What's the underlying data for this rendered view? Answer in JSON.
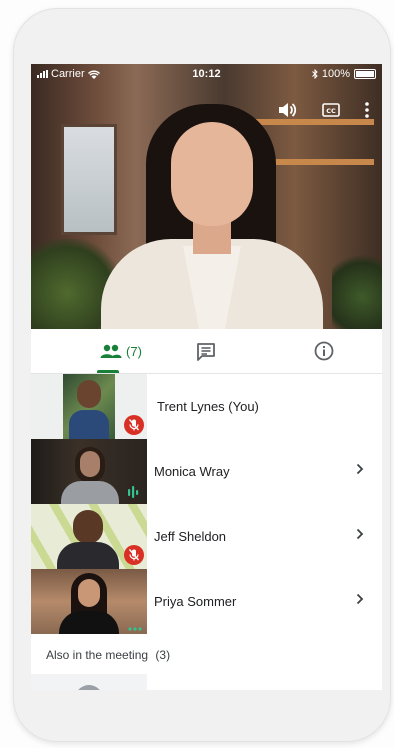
{
  "status_bar": {
    "carrier": "Carrier",
    "time": "10:12",
    "battery": "100%"
  },
  "tabs": {
    "people_count": "(7)"
  },
  "participants": [
    {
      "name": "Trent Lynes (You)",
      "muted": true
    },
    {
      "name": "Monica Wray",
      "speaking": true
    },
    {
      "name": "Jeff Sheldon",
      "muted": true
    },
    {
      "name": "Priya Sommer",
      "more": true
    }
  ],
  "also_in_meeting": {
    "label": "Also in the meeting",
    "count": "(3)"
  },
  "colors": {
    "accent_green": "#188038",
    "mic_off_red": "#d93025"
  },
  "icons": [
    "speaker-icon",
    "captions-icon",
    "more-vert-icon",
    "people-icon",
    "chat-icon",
    "info-icon",
    "chevron-right-icon",
    "mic-off-icon",
    "audio-level-icon",
    "more-horiz-icon"
  ]
}
